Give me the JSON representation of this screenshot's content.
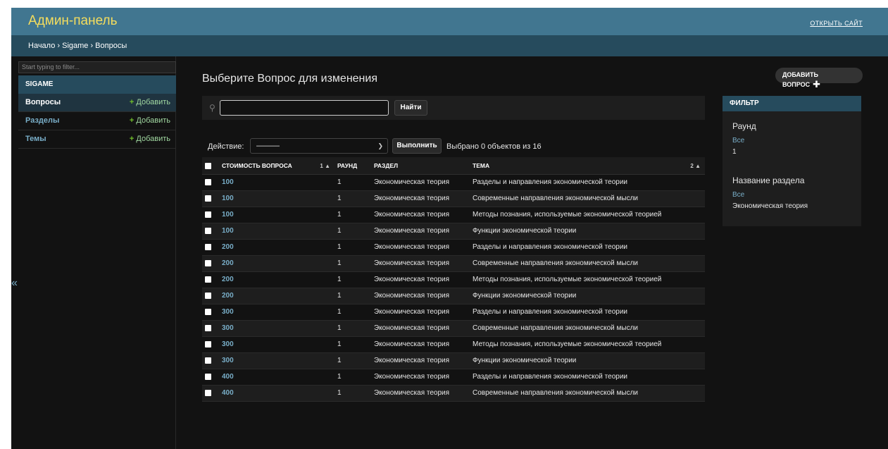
{
  "header": {
    "brand": "Админ-панель",
    "view_site": "ОТКРЫТЬ САЙТ"
  },
  "breadcrumbs": "Начало › Sigame › Вопросы",
  "sidebar": {
    "filter_placeholder": "Start typing to filter...",
    "app_caption": "SIGAME",
    "models": [
      {
        "name": "Вопросы",
        "add_label": "Добавить",
        "active": true
      },
      {
        "name": "Разделы",
        "add_label": "Добавить",
        "active": false
      },
      {
        "name": "Темы",
        "add_label": "Добавить",
        "active": false
      }
    ],
    "collapse_toggle": "«"
  },
  "main": {
    "title": "Выберите Вопрос для изменения",
    "add_button": "ДОБАВИТЬ ВОПРОС",
    "search": {
      "value": "",
      "button": "Найти"
    },
    "actions": {
      "label": "Действие:",
      "selected": "———",
      "go_button": "Выполнить",
      "counter": "Выбрано 0 объектов из 16"
    },
    "table": {
      "columns": [
        {
          "label": "СТОИМОСТЬ ВОПРОСА",
          "sort": "1 ▲"
        },
        {
          "label": "РАУНД",
          "sort": ""
        },
        {
          "label": "РАЗДЕЛ",
          "sort": ""
        },
        {
          "label": "ТЕМА",
          "sort": "2 ▲"
        }
      ],
      "rows": [
        {
          "cost": "100",
          "round": "1",
          "section": "Экономическая теория",
          "topic": "Разделы и направления экономической теории"
        },
        {
          "cost": "100",
          "round": "1",
          "section": "Экономическая теория",
          "topic": "Современные направления экономической мысли"
        },
        {
          "cost": "100",
          "round": "1",
          "section": "Экономическая теория",
          "topic": "Методы познания, используемые экономической теорией"
        },
        {
          "cost": "100",
          "round": "1",
          "section": "Экономическая теория",
          "topic": "Функции экономической теории"
        },
        {
          "cost": "200",
          "round": "1",
          "section": "Экономическая теория",
          "topic": "Разделы и направления экономической теории"
        },
        {
          "cost": "200",
          "round": "1",
          "section": "Экономическая теория",
          "topic": "Современные направления экономической мысли"
        },
        {
          "cost": "200",
          "round": "1",
          "section": "Экономическая теория",
          "topic": "Методы познания, используемые экономической теорией"
        },
        {
          "cost": "200",
          "round": "1",
          "section": "Экономическая теория",
          "topic": "Функции экономической теории"
        },
        {
          "cost": "300",
          "round": "1",
          "section": "Экономическая теория",
          "topic": "Разделы и направления экономической теории"
        },
        {
          "cost": "300",
          "round": "1",
          "section": "Экономическая теория",
          "topic": "Современные направления экономической мысли"
        },
        {
          "cost": "300",
          "round": "1",
          "section": "Экономическая теория",
          "topic": "Методы познания, используемые экономической теорией"
        },
        {
          "cost": "300",
          "round": "1",
          "section": "Экономическая теория",
          "topic": "Функции экономической теории"
        },
        {
          "cost": "400",
          "round": "1",
          "section": "Экономическая теория",
          "topic": "Разделы и направления экономической теории"
        },
        {
          "cost": "400",
          "round": "1",
          "section": "Экономическая теория",
          "topic": "Современные направления экономической мысли"
        }
      ]
    }
  },
  "filter": {
    "title": "ФИЛЬТР",
    "groups": [
      {
        "heading": "Раунд",
        "selected": "Все",
        "options": [
          "1"
        ]
      },
      {
        "heading": "Название раздела",
        "selected": "Все",
        "options": [
          "Экономическая теория"
        ]
      }
    ]
  },
  "colors": {
    "header": "#417690",
    "breadcrumbs": "#264b5d",
    "brand": "#f5dd5d",
    "link": "#79aec8",
    "add_plus": "#70bf2b",
    "background": "#121212"
  }
}
